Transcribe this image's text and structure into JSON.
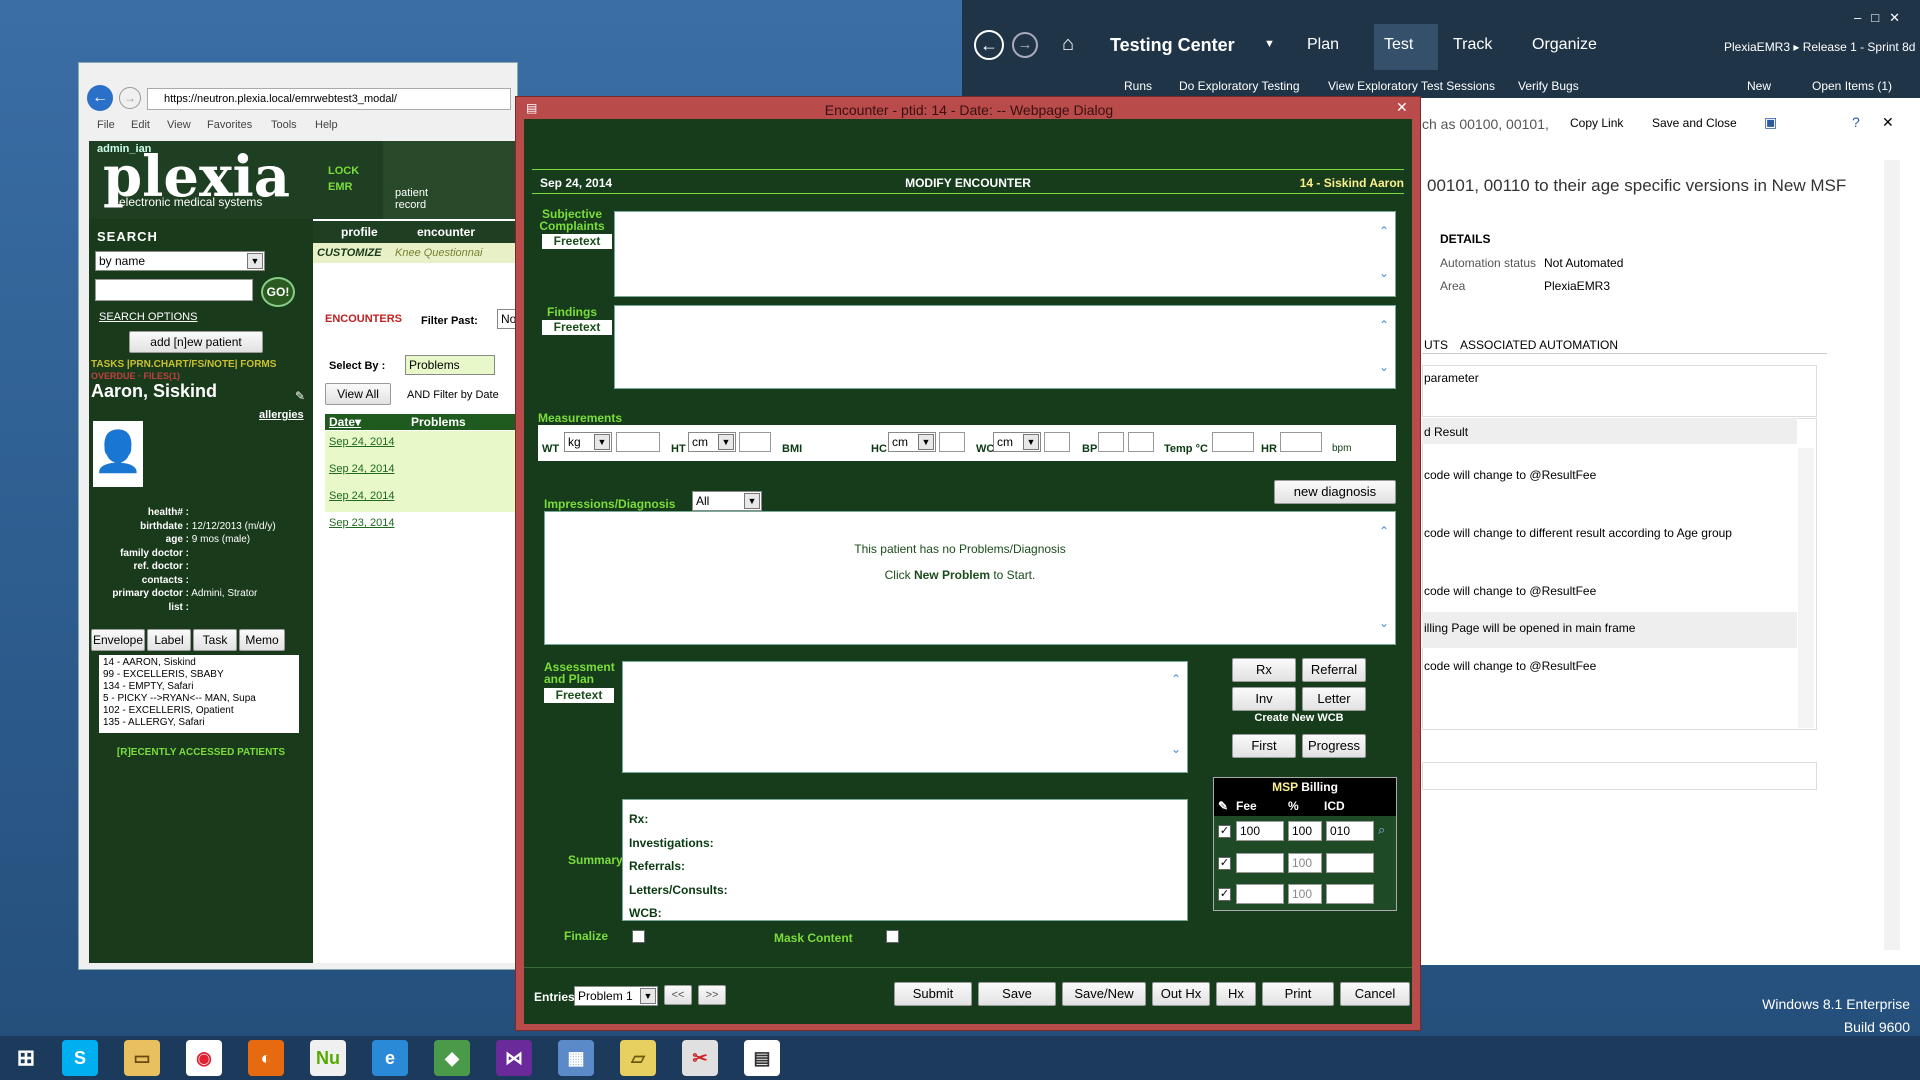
{
  "desktop": {
    "os": "Windows 8.1 Enterprise",
    "build": "Build 9600"
  },
  "testing_center": {
    "title": "Testing Center",
    "nav": [
      "Plan",
      "Test",
      "Track",
      "Organize"
    ],
    "breadcrumb": "PlexiaEMR3 ▸ Release 1 - Sprint 8d",
    "subnav": [
      "Runs",
      "Do Exploratory Testing",
      "View Exploratory Test Sessions",
      "Verify Bugs"
    ],
    "new_label": "New",
    "open_items": "Open Items (1)",
    "toolbar_text": "ch as 00100, 00101,",
    "copy_link": "Copy Link",
    "save_close": "Save and Close",
    "heading": "00101, 00110 to their age specific versions in New MSF",
    "details_label": "DETAILS",
    "automation_status_label": "Automation status",
    "automation_status": "Not Automated",
    "area_label": "Area",
    "area": "PlexiaEMR3",
    "tabs": [
      "UTS",
      "ASSOCIATED AUTOMATION"
    ],
    "parameter": "parameter",
    "result_header": "d Result",
    "results": [
      "code will change to @ResultFee",
      "code will change to different result according to Age group",
      "code will change to @ResultFee",
      "illing Page will be opened in main frame",
      "code will change to @ResultFee"
    ]
  },
  "ie": {
    "url": "https://neutron.plexia.local/emrwebtest3_modal/",
    "menu": [
      "File",
      "Edit",
      "View",
      "Favorites",
      "Tools",
      "Help"
    ],
    "admin": "admin_ian",
    "logo": "plexia",
    "logo_sub": "electronic medical systems",
    "lock": "LOCK",
    "emr": "EMR",
    "patient_record": "patient record",
    "search_label": "SEARCH",
    "search_by": "by name",
    "go": "GO!",
    "search_options": "SEARCH OPTIONS",
    "add_patient": "add [n]ew patient",
    "links": "TASKS |PRN.CHART/FS/NOTE| FORMS",
    "overdue": "OVERDUE · FILES(1)",
    "patient_name": "Aaron, Siskind",
    "allergies": "allergies",
    "info": [
      [
        "health# :",
        ""
      ],
      [
        "birthdate :",
        "12/12/2013 (m/d/y)"
      ],
      [
        "age :",
        "9 mos (male)"
      ],
      [
        "family doctor :",
        ""
      ],
      [
        "ref. doctor :",
        ""
      ],
      [
        "contacts :",
        ""
      ],
      [
        "primary doctor :",
        "Admini, Strator"
      ],
      [
        "list :",
        ""
      ]
    ],
    "tabs": [
      "Envelope",
      "Label",
      "Task",
      "Memo"
    ],
    "patient_list": [
      "14 - AARON, Siskind",
      "99 - EXCELLERIS, SBABY",
      "134 - EMPTY, Safari",
      "5 - PICKY -->RYAN<-- MAN, Supa",
      "102 - EXCELLERIS, Opatient",
      "135 - ALLERGY, Safari"
    ],
    "recent": "[R]ECENTLY ACCESSED PATIENTS",
    "profile_tab": "profile",
    "encounter_tab": "encounter",
    "customize": "CUSTOMIZE",
    "knee": "Knee Questionnai",
    "encounters": "ENCOUNTERS",
    "filter_past": "Filter Past:",
    "filter_val": "No",
    "select_by": "Select By :",
    "select_val": "Problems",
    "view_all": "View All",
    "and_filter": "AND Filter by Date",
    "col_date": "Date▾",
    "col_problems": "Problems",
    "dates": [
      "Sep 24, 2014",
      "Sep 24, 2014",
      "Sep 24, 2014",
      "Sep 23, 2014"
    ]
  },
  "dialog": {
    "title": "Encounter - ptid: 14 - Date: -- Webpage Dialog",
    "date": "Sep 24, 2014",
    "mode": "MODIFY ENCOUNTER",
    "patient": "14 - Siskind Aaron",
    "subjective": "Subjective Complaints",
    "findings": "Findings",
    "freetext": "Freetext",
    "measurements": "Measurements",
    "wt": "WT",
    "kg": "kg",
    "ht": "HT",
    "cm": "cm",
    "bmi": "BMI",
    "hc": "HC",
    "wc": "WC",
    "bp": "BP",
    "temp": "Temp °C",
    "hr": "HR",
    "bpm": "bpm",
    "impressions": "Impressions/Diagnosis",
    "imp_filter": "All",
    "new_diagnosis": "new diagnosis",
    "no_problems": "This patient has no Problems/Diagnosis",
    "click_pre": "Click ",
    "click_bold": "New Problem",
    "click_post": " to Start.",
    "assessment": "Assessment and Plan",
    "rx": "Rx",
    "referral": "Referral",
    "inv": "Inv",
    "letter": "Letter",
    "create_wcb": "Create New WCB",
    "first": "First",
    "progress": "Progress",
    "summary_label": "Summary",
    "summary_items": [
      "Rx:",
      "Investigations:",
      "Referrals:",
      "Letters/Consults:",
      "WCB:"
    ],
    "msp": "MSP",
    "billing": "Billing",
    "fee": "Fee",
    "pct": "%",
    "icd": "ICD",
    "billing_rows": [
      {
        "fee": "100",
        "pct": "100",
        "icd": "010"
      },
      {
        "fee": "",
        "pct": "100",
        "icd": ""
      },
      {
        "fee": "",
        "pct": "100",
        "icd": ""
      }
    ],
    "finalize": "Finalize",
    "mask_content": "Mask Content",
    "entries": "Entries",
    "entries_val": "Problem 1",
    "prev": "<<",
    "next": ">>",
    "buttons": [
      "Submit",
      "Save",
      "Save/New",
      "Out Hx",
      "Hx",
      "Print",
      "Cancel"
    ]
  }
}
